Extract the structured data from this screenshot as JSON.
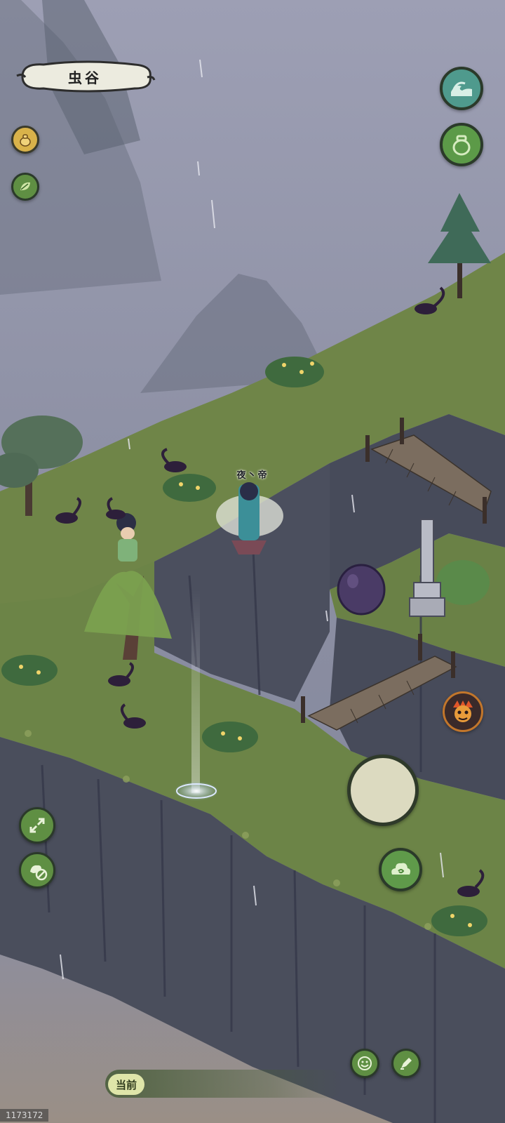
{
  "location": {
    "name": "虫谷"
  },
  "player": {
    "name": "夜丶帝"
  },
  "chat": {
    "tag": "当前",
    "message": ""
  },
  "build_id": "1173172",
  "buttons": {
    "top_left": [
      {
        "icon": "gourd-pouch-icon"
      },
      {
        "icon": "leaf-icon"
      }
    ],
    "top_right": [
      {
        "icon": "wave-icon"
      },
      {
        "icon": "jar-icon"
      }
    ],
    "left_side": [
      {
        "icon": "expand-arrows-icon"
      },
      {
        "icon": "no-pet-icon"
      }
    ],
    "right_side": [
      {
        "icon": "demon-face-icon"
      },
      {
        "icon": "cloud-swirl-icon"
      }
    ],
    "bottom": [
      {
        "icon": "smiley-icon"
      },
      {
        "icon": "pen-check-icon"
      }
    ]
  },
  "colors": {
    "sky": "#8f93a6",
    "grass": "#6f8548",
    "cliff": "#4b4f5e",
    "accent_green": "#5f8f43",
    "scorpion": "#2d1f3a"
  }
}
